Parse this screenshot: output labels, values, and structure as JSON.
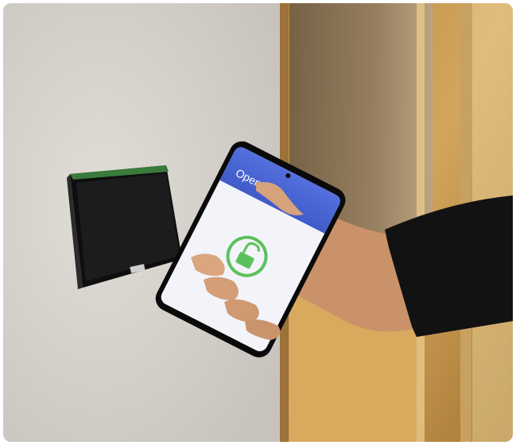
{
  "photo": {
    "phone_screen": {
      "app_name": "Openow",
      "status_icon": "unlock-icon"
    },
    "colors": {
      "wall": "#d6d2cc",
      "door_glass": "#c79a52",
      "door_frame": "#8a6a3a",
      "reader_body": "#141414",
      "reader_led": "#4caf50",
      "phone_header": "#4e6bd8",
      "phone_screen_bg": "#f4f5fa",
      "unlock_green": "#5cc15c",
      "sleeve": "#121212",
      "skin": "#d4a27e"
    }
  }
}
